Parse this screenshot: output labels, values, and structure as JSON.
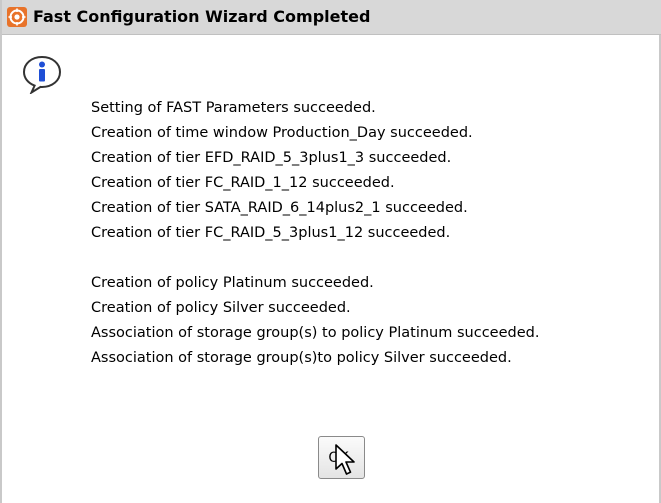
{
  "window": {
    "title": "Fast Configuration Wizard Completed",
    "app_icon": "app-logo-icon",
    "message_icon": "info-icon"
  },
  "messages": [
    "Setting of FAST Parameters succeeded.",
    "Creation of time window Production_Day succeeded.",
    "Creation of tier EFD_RAID_5_3plus1_3 succeeded.",
    "Creation of tier FC_RAID_1_12 succeeded.",
    "Creation of tier SATA_RAID_6_14plus2_1 succeeded.",
    "Creation of tier FC_RAID_5_3plus1_12 succeeded.",
    "",
    "Creation of policy Platinum succeeded.",
    "Creation of policy Silver succeeded.",
    "Association of storage group(s) to policy Platinum succeeded.",
    "Association of storage group(s)to policy Silver succeeded."
  ],
  "buttons": {
    "ok_label": "OK"
  },
  "colors": {
    "titlebar_bg": "#d8d8d8",
    "app_icon_orange": "#e8732a",
    "info_icon_blue": "#1f4fd6"
  }
}
